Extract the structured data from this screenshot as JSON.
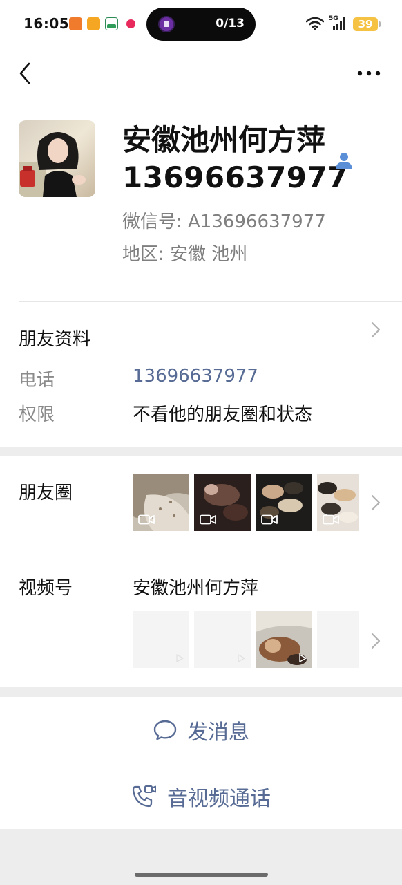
{
  "status_bar": {
    "time": "16:05",
    "notification_counter": "0/13",
    "network": "5G",
    "battery": "39"
  },
  "header": {
    "back_icon": "chevron-left-icon",
    "more_icon": "more-dots-icon"
  },
  "profile": {
    "name_line1": "安徽池州何方萍",
    "name_line2": "13696637977",
    "wechat_id": "微信号: A13696637977",
    "region": "地区: 安徽  池州",
    "contact_icon": "person-icon"
  },
  "friend_info": {
    "title": "朋友资料",
    "phone_label": "电话",
    "phone_value": "13696637977",
    "permission_label": "权限",
    "permission_value": "不看他的朋友圈和状态"
  },
  "moments": {
    "title": "朋友圈",
    "thumbnails": [
      "video-thumbnail",
      "video-thumbnail",
      "video-thumbnail",
      "video-thumbnail"
    ]
  },
  "channels": {
    "title": "视频号",
    "name": "安徽池州何方萍"
  },
  "actions": {
    "message_label": "发消息",
    "call_label": "音视频通话"
  },
  "colors": {
    "link_blue": "#576b95",
    "contact_icon_blue": "#5a8fd8",
    "battery_yellow": "#f6c244"
  }
}
